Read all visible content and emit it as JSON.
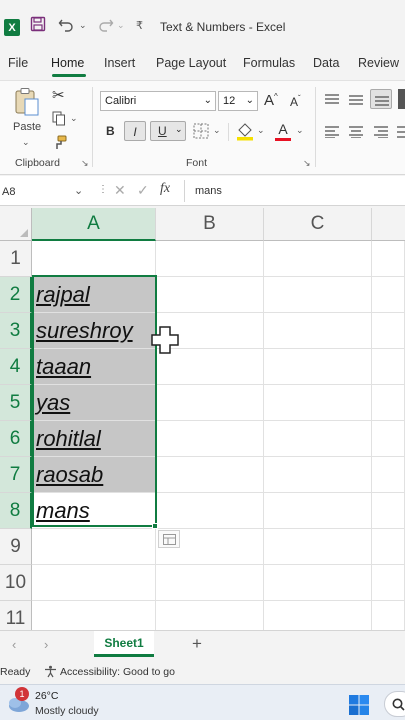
{
  "window": {
    "title": "Text & Numbers  -  Excel"
  },
  "menu": {
    "tabs": [
      "File",
      "Home",
      "Insert",
      "Page Layout",
      "Formulas",
      "Data",
      "Review"
    ]
  },
  "ribbon": {
    "paste_label": "Paste",
    "clipboard_label": "Clipboard",
    "font_label": "Font",
    "font_name": "Calibri",
    "font_size": "12",
    "bold": "B",
    "italic": "I",
    "underline": "U",
    "grow_font": "A",
    "shrink_font": "A",
    "font_color_letter": "A"
  },
  "formula_bar": {
    "name_box": "A8",
    "fx": "fx",
    "value": "mans"
  },
  "grid": {
    "columns": [
      "A",
      "B",
      "C"
    ],
    "rows": [
      "1",
      "2",
      "3",
      "4",
      "5",
      "6",
      "7",
      "8",
      "9",
      "10",
      "11"
    ],
    "cells_a": [
      "",
      "rajpal",
      "sureshroy",
      "taaan",
      "yas",
      "rohitlal",
      "raosab",
      "mans",
      "",
      "",
      ""
    ]
  },
  "sheets": {
    "active": "Sheet1",
    "add": "+"
  },
  "status": {
    "ready": "Ready",
    "accessibility": "Accessibility: Good to go"
  },
  "taskbar": {
    "temp": "26°C",
    "weather": "Mostly cloudy",
    "notif_count": "1"
  },
  "colors": {
    "accent": "#107c41",
    "selection_fill": "#c6c6c6",
    "header_selected": "#d3e7da"
  }
}
